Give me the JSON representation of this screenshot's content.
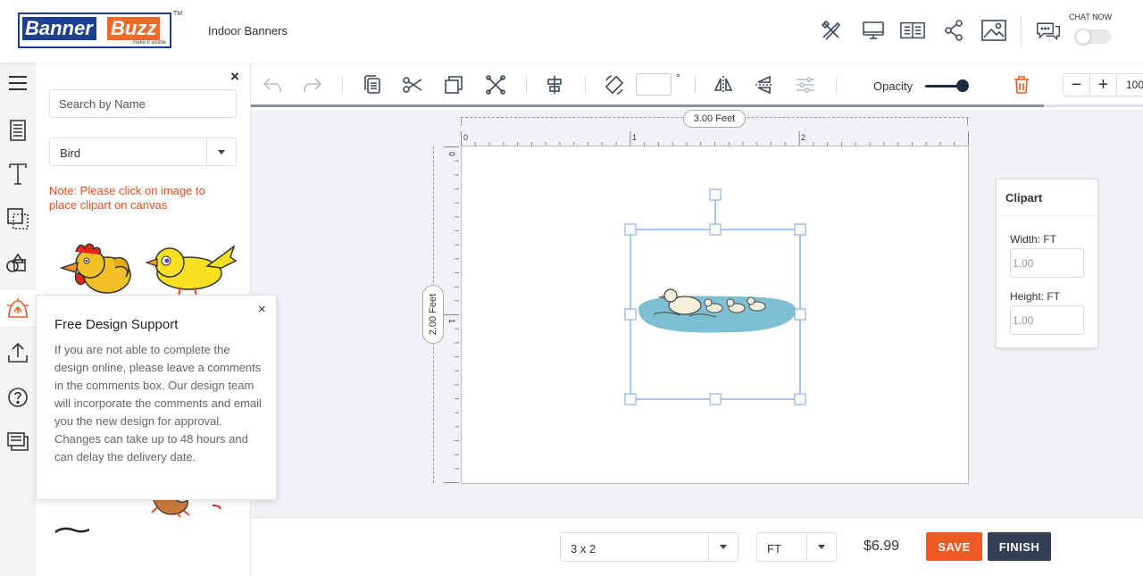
{
  "header": {
    "logo_banner": "Banner",
    "logo_buzz": "Buzz",
    "logo_tagline": "make it visible",
    "logo_tm": "TM",
    "page_title": "Indoor Banners",
    "icons": [
      "design-tools-icon",
      "desktop-preview-icon",
      "book-preview-icon",
      "share-icon",
      "image-icon",
      "chat-icon"
    ],
    "chat_now_label": "CHAT NOW",
    "chat_toggle_on": false
  },
  "sidebar": {
    "items": [
      {
        "name": "menu-icon"
      },
      {
        "name": "template-icon"
      },
      {
        "name": "text-icon"
      },
      {
        "name": "background-icon"
      },
      {
        "name": "shapes-icon"
      },
      {
        "name": "clipart-icon",
        "active": true
      },
      {
        "name": "upload-icon"
      },
      {
        "name": "help-icon"
      },
      {
        "name": "comments-icon"
      }
    ]
  },
  "clipart_panel": {
    "close_label": "×",
    "search_placeholder": "Search by Name",
    "category_value": "Bird",
    "note": "Note: Please click on image to place clipart on canvas"
  },
  "support_popup": {
    "title": "Free Design Support",
    "close_label": "×",
    "body": "If you are not able to complete the design online, please leave a comments in the comments box. Our design team will incorporate the comments and email you the new design for approval. Changes can take up to 48 hours and can delay the delivery date."
  },
  "toolbar": {
    "degree_symbol": "°",
    "rotation_value": "",
    "opacity_label": "Opacity",
    "opacity_value": 1.0,
    "zoom_minus": "−",
    "zoom_plus": "+",
    "zoom_value": "100",
    "accent_delete_color": "#ee5a24"
  },
  "workspace": {
    "width_label": "3.00 Feet",
    "height_label": "2.00 Feet",
    "ruler_h_labels": [
      "0",
      "1",
      "2"
    ],
    "ruler_v_labels": [
      "0",
      "1"
    ]
  },
  "clipart_props": {
    "title": "Clipart",
    "width_label": "Width: FT",
    "width_value": "1.00",
    "height_label": "Height: FT",
    "height_value": "1.00"
  },
  "bottombar": {
    "size_value": "3 x 2",
    "unit_value": "FT",
    "price": "$6.99",
    "save_label": "SAVE",
    "finish_label": "FINISH",
    "save_color": "#ee5a24",
    "finish_color": "#333f52"
  }
}
